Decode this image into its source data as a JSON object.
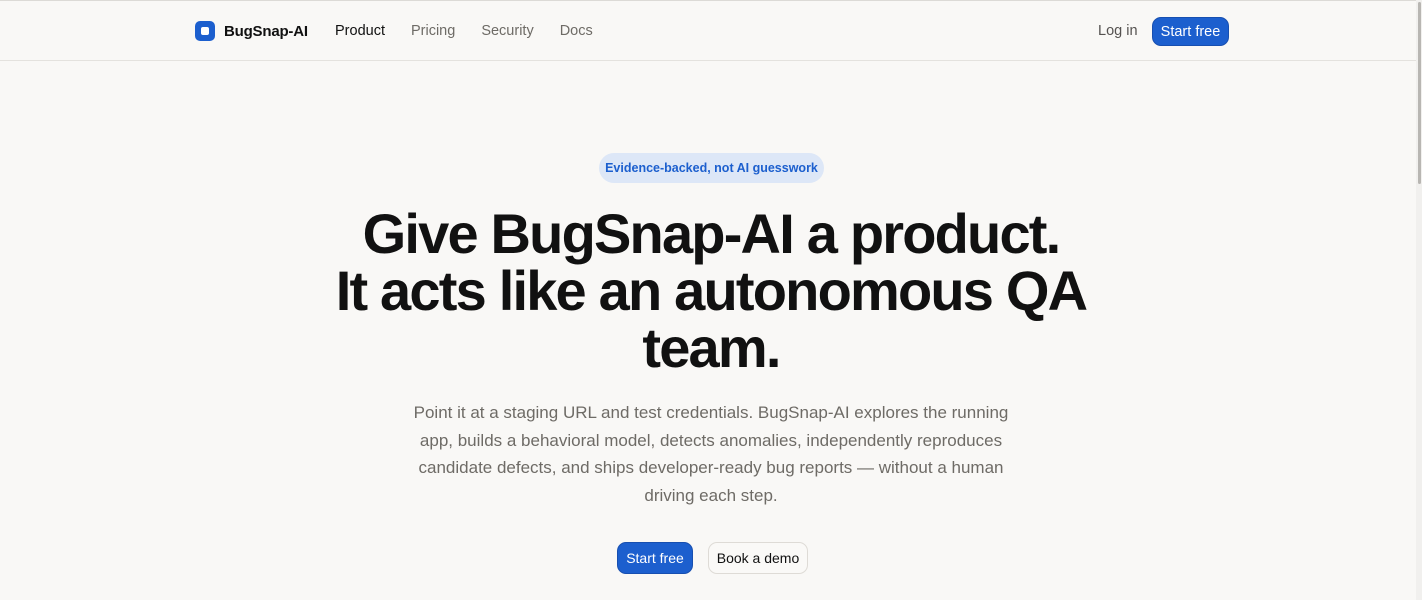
{
  "header": {
    "brand_name": "BugSnap-AI",
    "nav": [
      "Product",
      "Pricing",
      "Security",
      "Docs"
    ],
    "active_nav": "Product",
    "login_label": "Log in",
    "cta_label": "Start free"
  },
  "hero": {
    "badge": "Evidence-backed, not AI guesswork",
    "headline_line1": "Give BugSnap-AI a product.",
    "headline_line2": "It acts like an autonomous QA",
    "headline_line3": "team.",
    "subtext": "Point it at a staging URL and test credentials. BugSnap-AI explores the running app, builds a behavioral model, detects anomalies, independently reproduces candidate defects, and ships developer-ready bug reports — without a human driving each step.",
    "primary_cta": "Start free",
    "secondary_cta": "Book a demo"
  },
  "icons": {
    "brand": "logo-mark-icon"
  },
  "colors": {
    "accent": "#1c5fce",
    "background": "#f9f8f6",
    "badge_background": "#dde7f7",
    "heading": "#111111",
    "muted_text": "#6e6b66"
  }
}
